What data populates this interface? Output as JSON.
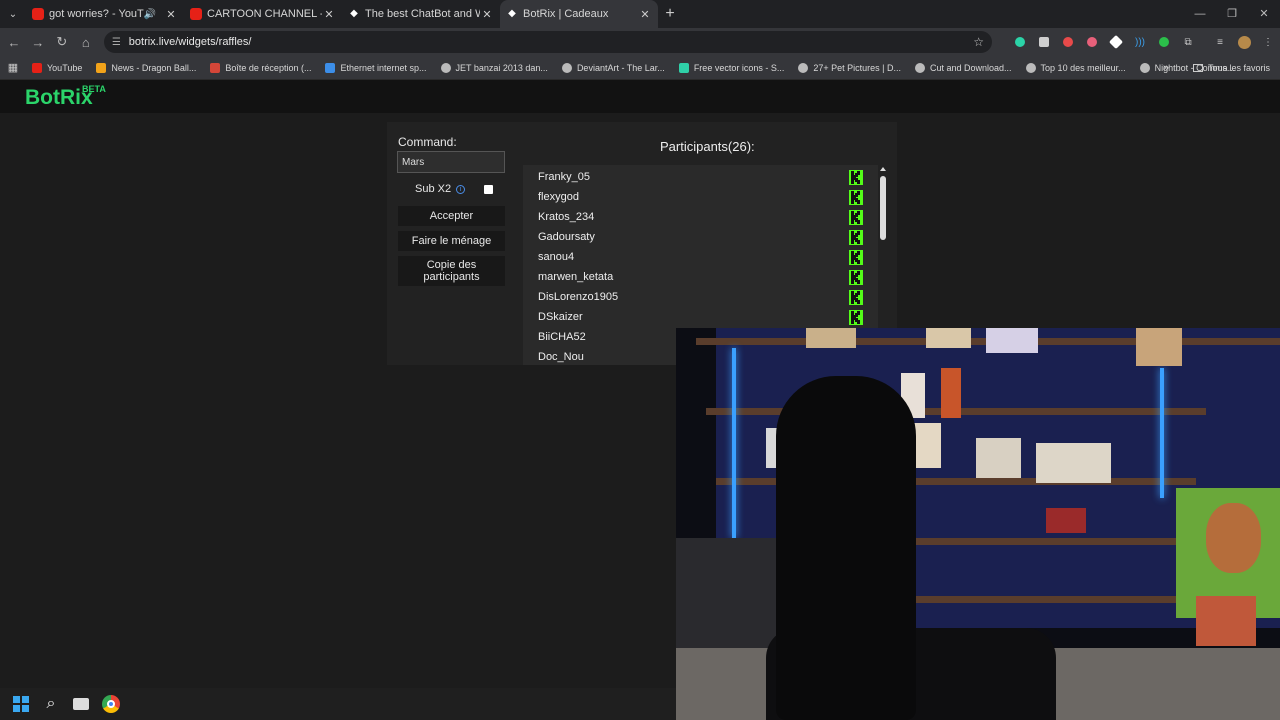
{
  "browser": {
    "tabs": [
      {
        "title": "got worries? - YouTube",
        "icon": "youtube-icon",
        "audio": true
      },
      {
        "title": "CARTOON CHANNEL - YouTube",
        "icon": "youtube-icon",
        "audio": false
      },
      {
        "title": "The best ChatBot and Widgets",
        "icon": "botrix-icon",
        "audio": false
      },
      {
        "title": "BotRix | Cadeaux",
        "icon": "botrix-icon",
        "audio": false,
        "active": true
      }
    ],
    "url": "botrix.live/widgets/raffles/",
    "bookmarks": [
      {
        "label": "YouTube",
        "color": "#e62117"
      },
      {
        "label": "News - Dragon Ball...",
        "color": "#f2a31a"
      },
      {
        "label": "Boîte de réception (...",
        "color": "#d44638"
      },
      {
        "label": "Ethernet internet sp...",
        "color": "#3c8ee8"
      },
      {
        "label": "JET banzai 2013 dan...",
        "color": "#bbbbbb"
      },
      {
        "label": "DeviantArt - The Lar...",
        "color": "#bbbbbb"
      },
      {
        "label": "Free vector icons - S...",
        "color": "#2fd0a8"
      },
      {
        "label": "27+ Pet Pictures | D...",
        "color": "#bbbbbb"
      },
      {
        "label": "Cut and Download...",
        "color": "#bbbbbb"
      },
      {
        "label": "Top 10 des meilleur...",
        "color": "#bbbbbb"
      },
      {
        "label": "Nightbot - Comma...",
        "color": "#bbbbbb"
      }
    ],
    "all_bookmarks": "Tous les favoris"
  },
  "site": {
    "logo": "BotRix",
    "logo_badge": "BETA"
  },
  "raffle": {
    "command_label": "Command:",
    "command_value": "Mars",
    "sub_label": "Sub X2",
    "sub_checked": false,
    "accept_button": "Accepter",
    "clear_button": "Faire le ménage",
    "copy_button": "Copie des participants",
    "participants_title": "Participants(26):",
    "participants": [
      "Franky_05",
      "flexygod",
      "Kratos_234",
      "Gadoursaty",
      "sanou4",
      "marwen_ketata",
      "DisLorenzo1905",
      "DSkaizer",
      "BiiCHA52",
      "Doc_Nou"
    ]
  },
  "colors": {
    "brand": "#2bd46a",
    "kick": "#53fc18"
  }
}
